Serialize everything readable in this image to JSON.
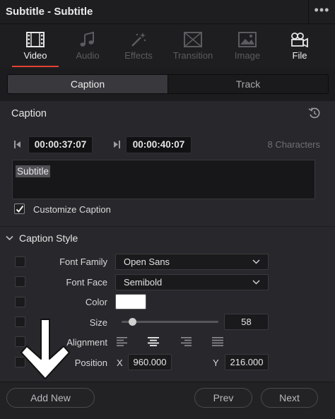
{
  "window": {
    "title": "Subtitle - Subtitle",
    "menu_glyph": "•••"
  },
  "tabs": [
    {
      "label": "Video",
      "icon": "film-icon",
      "state": "active"
    },
    {
      "label": "Audio",
      "icon": "music-note-icon",
      "state": "disabled"
    },
    {
      "label": "Effects",
      "icon": "magic-wand-icon",
      "state": "disabled"
    },
    {
      "label": "Transition",
      "icon": "transition-icon",
      "state": "disabled"
    },
    {
      "label": "Image",
      "icon": "image-icon",
      "state": "disabled"
    },
    {
      "label": "File",
      "icon": "file-film-icon",
      "state": "enabled"
    }
  ],
  "segmented": {
    "caption": "Caption",
    "track": "Track",
    "selected": "Caption"
  },
  "caption": {
    "section_title": "Caption",
    "in_timecode": "00:00:37:07",
    "out_timecode": "00:00:40:07",
    "char_count": "8 Characters",
    "text": "Subtitle",
    "customize_label": "Customize Caption",
    "customize_checked": true
  },
  "caption_style": {
    "section_title": "Caption Style",
    "font_family_label": "Font Family",
    "font_family_value": "Open Sans",
    "font_face_label": "Font Face",
    "font_face_value": "Semibold",
    "color_label": "Color",
    "color_value": "#ffffff",
    "size_label": "Size",
    "size_value": "58",
    "alignment_label": "Alignment",
    "alignment_options": [
      "align-left-icon",
      "align-center-icon",
      "align-right-icon",
      "align-justify-icon"
    ],
    "alignment_selected": "align-center-icon",
    "position_label": "Position",
    "x_label": "X",
    "x_value": "960.000",
    "y_label": "Y",
    "y_value": "216.000"
  },
  "footer": {
    "add_new": "Add New",
    "prev": "Prev",
    "next": "Next"
  },
  "colors": {
    "accent": "#e2422f",
    "panel": "#28282c",
    "background": "#1c1c1f"
  }
}
